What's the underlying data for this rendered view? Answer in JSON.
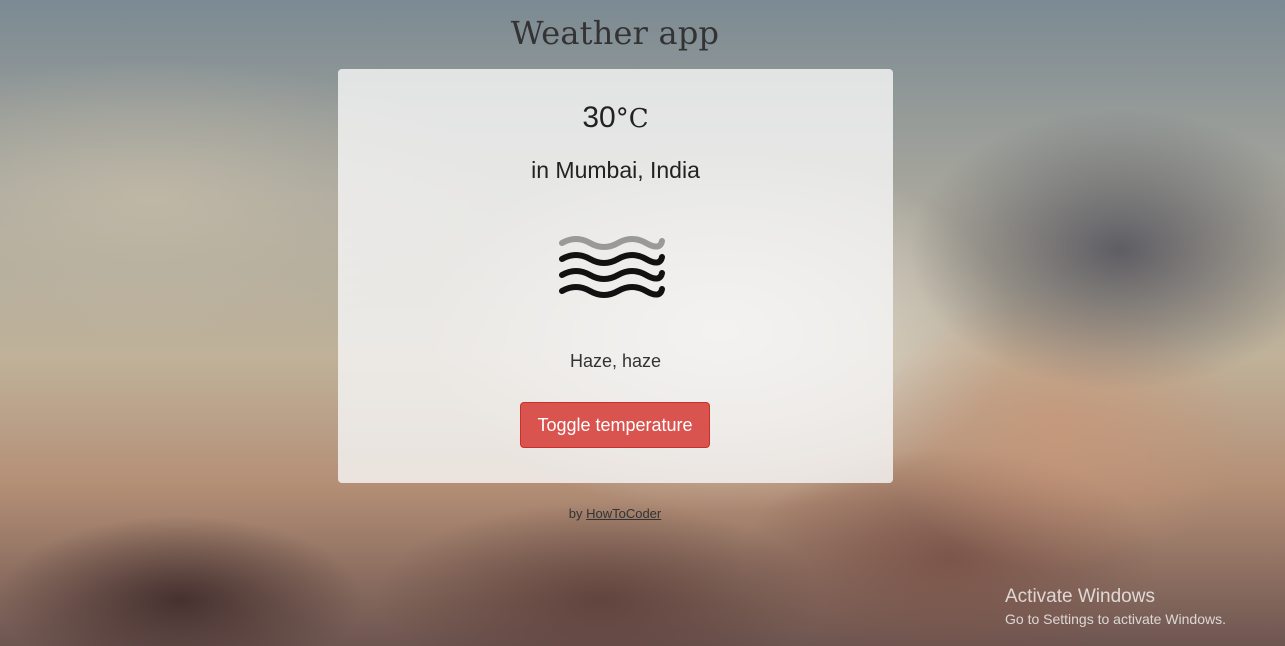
{
  "page": {
    "title": "Weather app"
  },
  "weather": {
    "temperature_value": "30",
    "temperature_unit": "°C",
    "location": "in Mumbai, India",
    "description": "Haze, haze",
    "icon": "haze-icon"
  },
  "controls": {
    "toggle_label": "Toggle temperature",
    "toggle_color": "#d9534f"
  },
  "footer": {
    "by_text": "by",
    "author_link": "HowToCoder"
  },
  "os_overlay": {
    "line1": "Activate Windows",
    "line2": "Go to Settings to activate Windows."
  }
}
